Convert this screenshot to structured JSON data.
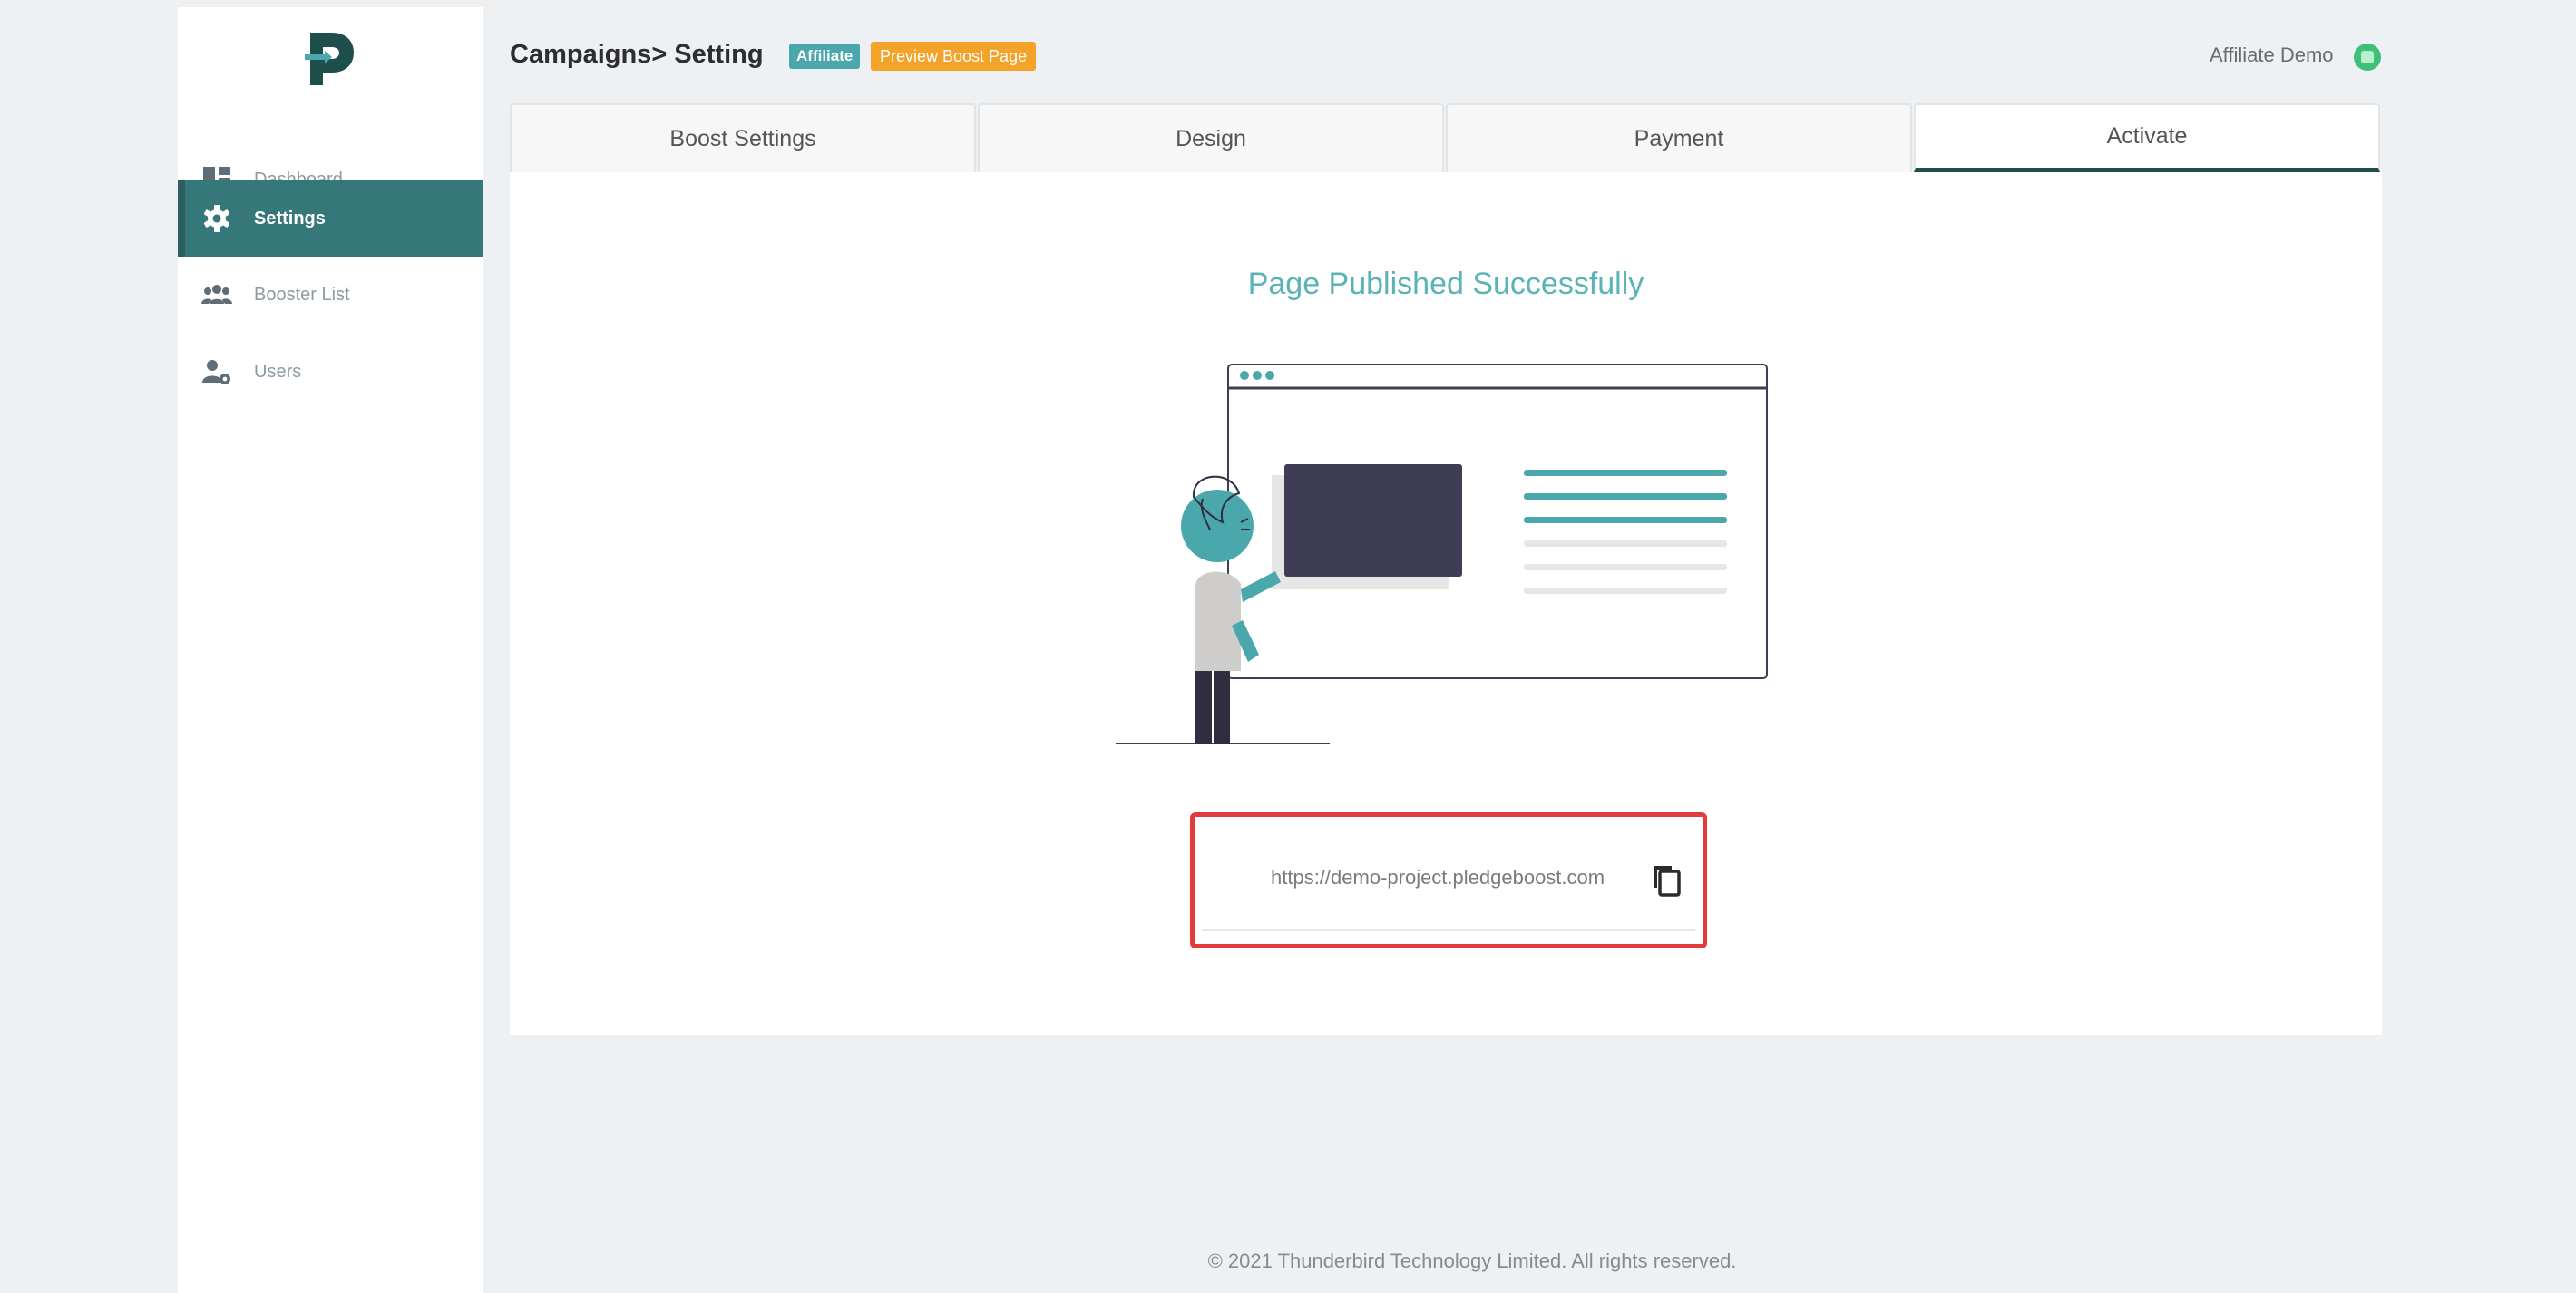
{
  "sidebar": {
    "items": [
      {
        "label": "Dashboard",
        "icon": "dashboard-icon"
      },
      {
        "label": "Settings",
        "icon": "gear-icon"
      },
      {
        "label": "Booster List",
        "icon": "users-group-icon"
      },
      {
        "label": "Users",
        "icon": "user-settings-icon"
      }
    ],
    "active_index": 1
  },
  "header": {
    "title": "Campaigns> Setting",
    "badge_affiliate": "Affiliate",
    "badge_preview": "Preview Boost Page",
    "user_name": "Affiliate Demo"
  },
  "tabs": [
    {
      "label": "Boost Settings"
    },
    {
      "label": "Design"
    },
    {
      "label": "Payment"
    },
    {
      "label": "Activate"
    }
  ],
  "active_tab": 3,
  "main": {
    "success_title": "Page Published Successfully",
    "url": "https://demo-project.pledgeboost.com"
  },
  "footer": {
    "text": "© 2021 Thunderbird Technology Limited. All rights reserved."
  },
  "colors": {
    "accent_teal": "#36787a",
    "success_text": "#5ab3b6",
    "badge_affiliate": "#4aa7ab",
    "badge_preview": "#f3a32a",
    "highlight_red": "#e33b3b"
  }
}
